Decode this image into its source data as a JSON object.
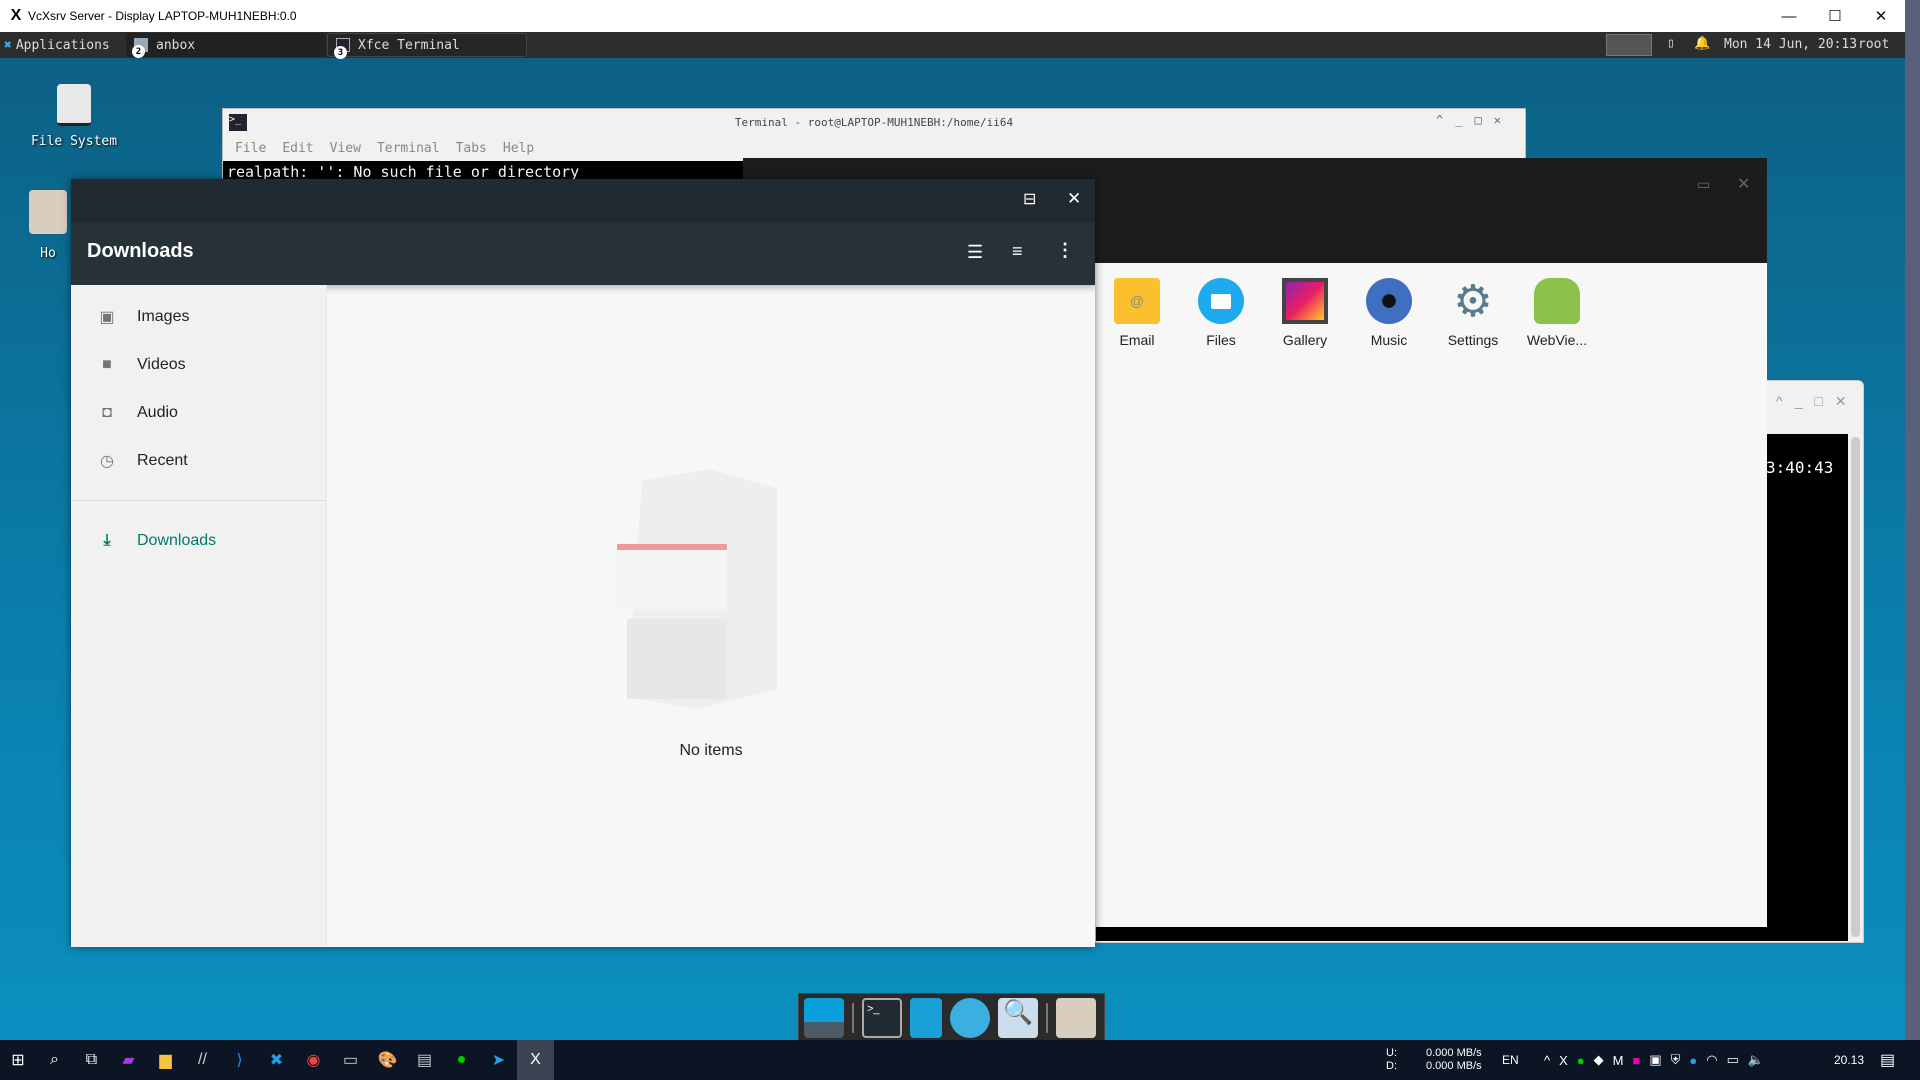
{
  "vcxsrv": {
    "title": "VcXsrv Server - Display LAPTOP-MUH1NEBH:0.0",
    "controls": [
      "minimize",
      "maximize",
      "close"
    ]
  },
  "xfce_panel": {
    "applications_label": "Applications",
    "tasks": [
      {
        "label": "anbox",
        "badge": "2"
      },
      {
        "label": "Xfce Terminal",
        "badge": "3"
      }
    ],
    "clock": "Mon 14 Jun, 20:13",
    "user": "root"
  },
  "desktop_icons": [
    {
      "label": "File System",
      "icon": "harddisk-icon"
    },
    {
      "label": "Ho",
      "icon": "home-folder-icon"
    }
  ],
  "terminal": {
    "title": "Terminal - root@LAPTOP-MUH1NEBH:/home/ii64",
    "menu": [
      "File",
      "Edit",
      "View",
      "Terminal",
      "Tabs",
      "Help"
    ],
    "output": "realpath: '': No such file or directory"
  },
  "right_terminal": {
    "output": "3:40:43"
  },
  "anbox": {
    "apps": [
      {
        "label": "Email",
        "icon": "email-icon"
      },
      {
        "label": "Files",
        "icon": "files-icon"
      },
      {
        "label": "Gallery",
        "icon": "gallery-icon"
      },
      {
        "label": "Music",
        "icon": "music-icon"
      },
      {
        "label": "Settings",
        "icon": "settings-icon"
      },
      {
        "label": "WebVie...",
        "icon": "android-icon"
      }
    ]
  },
  "file_manager": {
    "title": "Downloads",
    "sidebar": [
      {
        "label": "Images",
        "icon": "image-icon"
      },
      {
        "label": "Videos",
        "icon": "video-icon"
      },
      {
        "label": "Audio",
        "icon": "audio-icon"
      },
      {
        "label": "Recent",
        "icon": "clock-icon"
      }
    ],
    "active_root": {
      "label": "Downloads",
      "icon": "download-icon"
    },
    "empty_message": "No items",
    "accent": "#00796b"
  },
  "win_tray": {
    "upload_label": "U:",
    "download_label": "D:",
    "upload_rate": "0.000 MB/s",
    "download_rate": "0.000 MB/s",
    "language": "EN",
    "time": "20.13"
  }
}
